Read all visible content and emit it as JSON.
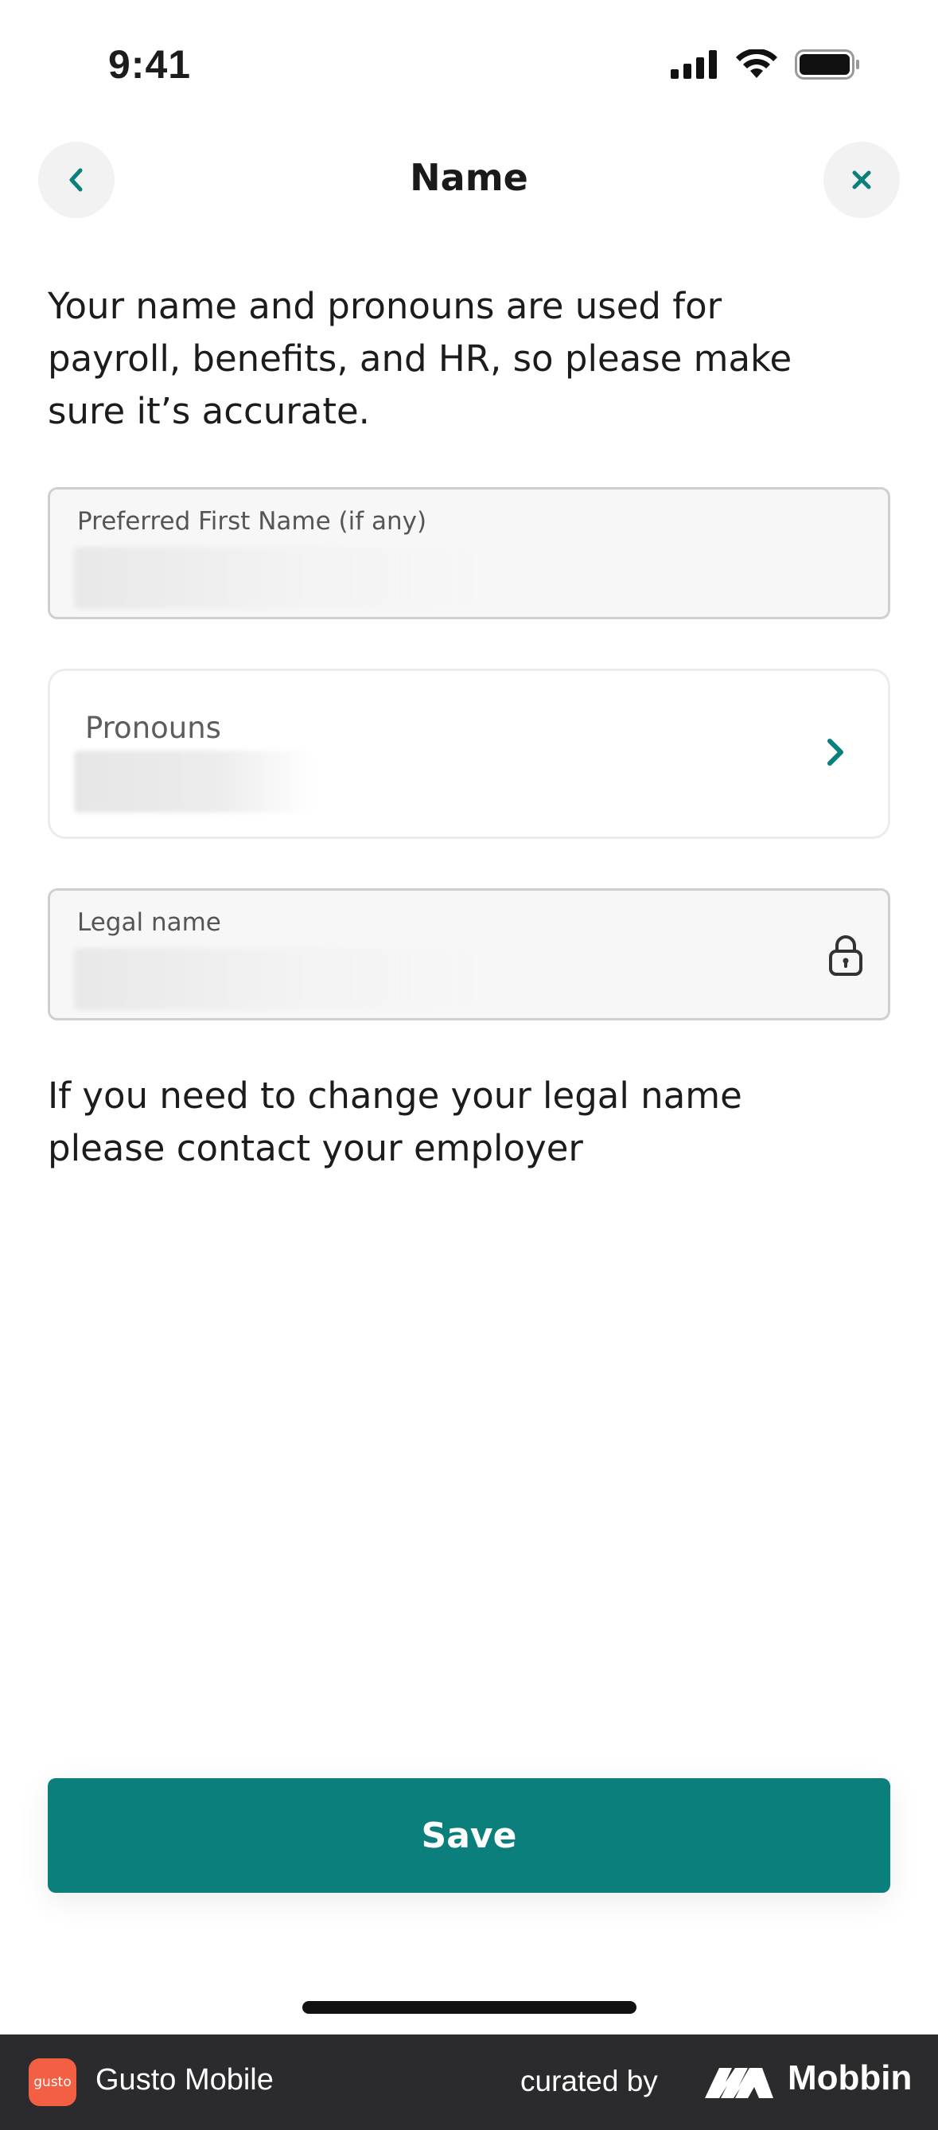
{
  "status_bar": {
    "time": "9:41",
    "icons": [
      "cellular-signal-icon",
      "wifi-icon",
      "battery-icon"
    ]
  },
  "header": {
    "title": "Name",
    "back_icon": "chevron-left-icon",
    "close_icon": "close-icon"
  },
  "intro_text": "Your name and pronouns are used for payroll, benefits, and HR, so please make sure it’s accurate.",
  "fields": {
    "preferred_first_name": {
      "label": "Preferred First Name (if any)"
    },
    "pronouns": {
      "label": "Pronouns",
      "icon": "chevron-right-icon"
    },
    "legal_name": {
      "label": "Legal name",
      "icon": "lock-icon"
    }
  },
  "legal_note": "If you need to change your legal name please contact your employer",
  "save_label": "Save",
  "banner": {
    "app_name": "Gusto Mobile",
    "app_logo_text": "gusto",
    "curated_by": "curated by",
    "brand": "Mobbin"
  },
  "colors": {
    "accent": "#0b7f7c",
    "banner_bg": "#2b2b2d",
    "app_logo_bg": "#f25f43"
  }
}
